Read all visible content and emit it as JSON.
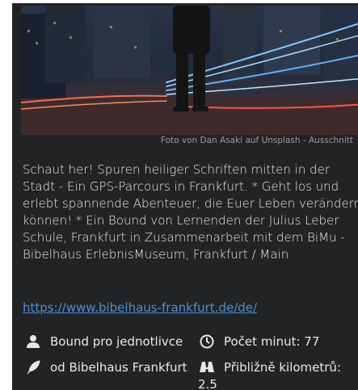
{
  "photo": {
    "caption": "Foto von Dan Asaki auf Unsplash - Ausschnitt"
  },
  "description": "Schaut her! Spuren heiliger Schriften mitten in der Stadt - Ein GPS-Parcours in Frankfurt. * Geht los und erlebt spannende Abenteuer, die Euer Leben verändern können! * Ein Bound von Lernenden der Julius Leber Schule, Frankfurt in Zusammenarbeit mit dem BiMu - Bibelhaus ErlebnisMuseum, Frankfurt / Main",
  "link": "https://www.bibelhaus-frankfurt.de/de/",
  "meta": {
    "bound_type": "Bound pro jednotlivce",
    "minutes": "Počet minut: 77",
    "author": "od Bibelhaus Frankfurt",
    "km_label": "Přibližně kilometrů:",
    "km_value": "2.5"
  },
  "icons": [
    "user-icon",
    "clock-icon",
    "feather-icon",
    "binoculars-icon"
  ],
  "colors": {
    "card_bg": "#222324",
    "link": "#4a90d9",
    "text": "#e8e8e8"
  }
}
